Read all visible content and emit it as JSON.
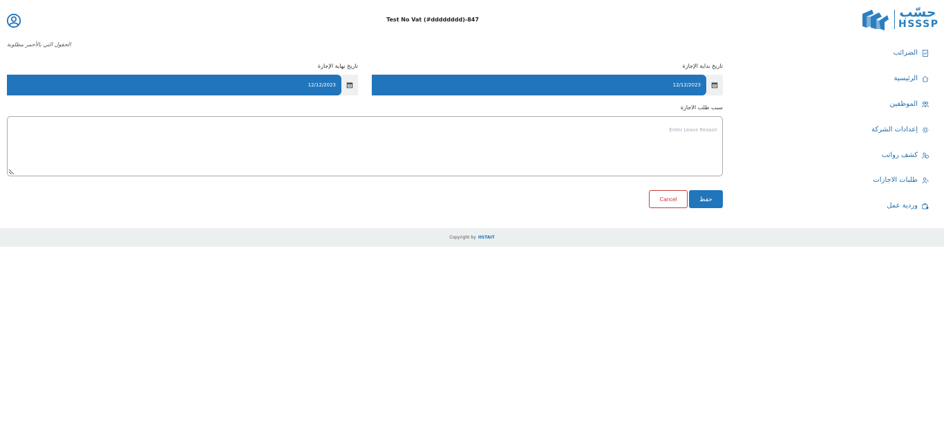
{
  "header": {
    "title": "Test No Vat (#dddddddd)-847",
    "account_icon": "user-circle-icon"
  },
  "logo": {
    "arabic": "حسّب",
    "english": "HSSSP",
    "accent": "#2a7fc0"
  },
  "sidebar": {
    "items": [
      {
        "label": "الضرائب",
        "icon": "tax-document-icon"
      },
      {
        "label": "الرئيسية",
        "icon": "home-icon"
      },
      {
        "label": "الموظفين",
        "icon": "employees-icon"
      },
      {
        "label": "إعدادات الشركة",
        "icon": "company-settings-icon"
      },
      {
        "label": "كشف رواتب",
        "icon": "payroll-icon"
      },
      {
        "label": "طلبات الاجازات",
        "icon": "leave-requests-icon"
      },
      {
        "label": "وردية عمل",
        "icon": "work-shift-icon"
      }
    ]
  },
  "form": {
    "required_note": "الحقول التي بالأحمر مطلوبة",
    "start_date": {
      "label": "تاريخ بداية الإجازة",
      "value": "12/12/2023"
    },
    "end_date": {
      "label": "تاريخ نهاية الإجازة",
      "value": "12/12/2023"
    },
    "reason": {
      "label": "سبب طلب الاجازة",
      "placeholder": "Enter Leave Reason"
    },
    "save_label": "حفظ",
    "cancel_label": "Cancel"
  },
  "footer": {
    "copyright": "Copyright by",
    "brand": "HSTAIT"
  },
  "colors": {
    "primary": "#2175bb",
    "danger": "#c73a3a",
    "footer_bg": "#eceff0"
  }
}
